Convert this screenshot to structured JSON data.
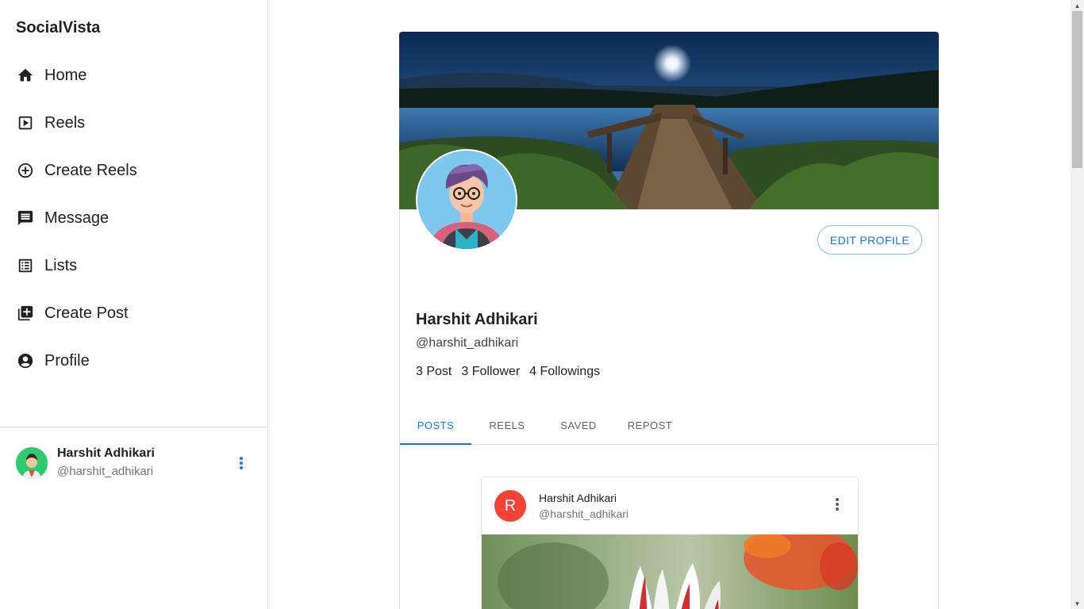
{
  "app": {
    "brand": "SocialVista"
  },
  "sidebar": {
    "items": [
      {
        "label": "Home",
        "icon": "home-icon"
      },
      {
        "label": "Reels",
        "icon": "reels-icon"
      },
      {
        "label": "Create Reels",
        "icon": "add-circle-icon"
      },
      {
        "label": "Message",
        "icon": "message-icon"
      },
      {
        "label": "Lists",
        "icon": "list-icon"
      },
      {
        "label": "Create Post",
        "icon": "add-post-icon"
      },
      {
        "label": "Profile",
        "icon": "profile-icon"
      }
    ],
    "user": {
      "name": "Harshit Adhikari",
      "handle": "@harshit_adhikari"
    }
  },
  "profile": {
    "name": "Harshit Adhikari",
    "handle": "@harshit_adhikari",
    "edit_label": "EDIT PROFILE",
    "stats": {
      "posts": "3 Post",
      "followers": "3 Follower",
      "followings": "4 Followings"
    },
    "tabs": [
      "POSTS",
      "REELS",
      "SAVED",
      "REPOST"
    ],
    "active_tab": "POSTS"
  },
  "post": {
    "avatar_letter": "R",
    "author": "Harshit Adhikari",
    "handle": "@harshit_adhikari"
  },
  "colors": {
    "accent": "#1976d2",
    "post_avatar": "#f44336",
    "side_avatar": "#2ecc71"
  }
}
